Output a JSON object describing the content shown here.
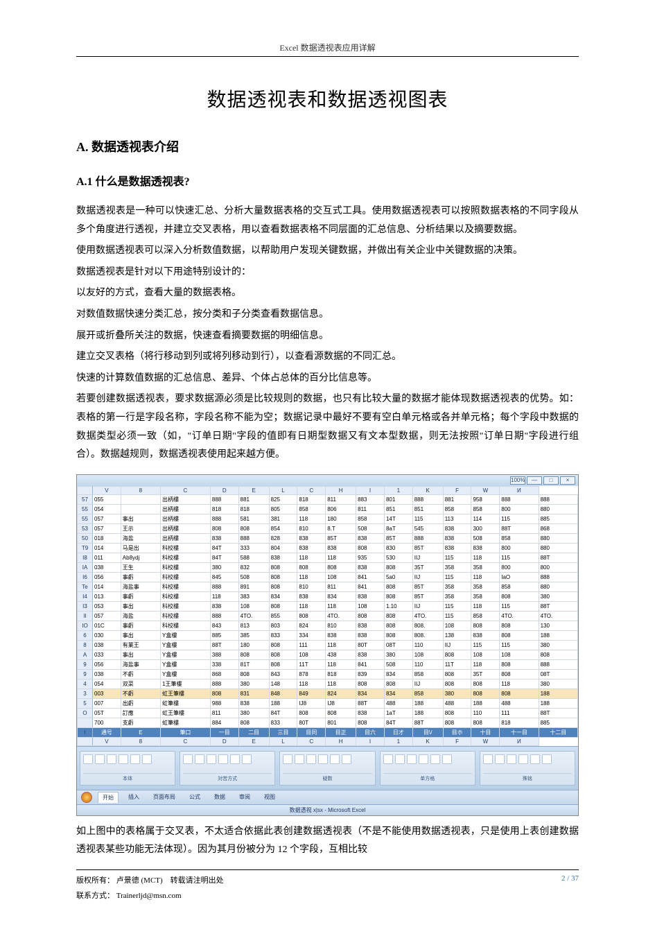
{
  "header": {
    "prefix": "Excel",
    "text": "数据透视表应用详解"
  },
  "title": "数据透视表和数据透视图表",
  "sectionA": {
    "label": "A.",
    "text": "数据透视表介绍"
  },
  "sectionA1": {
    "label": "A.1",
    "text": "什么是数据透视表",
    "qmark": "?"
  },
  "para1a": "数据透视表是一种可以快速汇总、分析大量数据表格的交互式工具。使用数据透视表可以按照数据表格的不同字段从多个角度进行透视，并建立交叉表格，用以查看数据表格不同层面的汇总信息、分析结果以及摘要数据。",
  "para1b": "使用数据透视表可以深入分析数值数据，以帮助用户发现关键数据，并做出有关企业中关键数据的决策。",
  "para2_lead": "数据透视表是针对以下用途特别设计的：",
  "para2_items": [
    "以友好的方式，查看大量的数据表格。",
    "对数值数据快速分类汇总，按分类和子分类查看数据信息。",
    "展开或折叠所关注的数据，快速查看摘要数据的明细信息。",
    "建立交叉表格（将行移动到列或将列移动到行），以查看源数据的不同汇总。",
    "快速的计算数值数据的汇总信息、差异、个体占总体的百分比信息等。"
  ],
  "para3": "若要创建数据透视表，要求数据源必须是比较规则的数据，也只有比较大量的数据才能体现数据透视表的优势。如：表格的第一行是字段名称，字段名称不能为空；数据记录中最好不要有空白单元格或各并单元格；每个字段中数据的数据类型必须一致（如，\"订单日期\"字段的值即有日期型数据又有文本型数据，则无法按照\"订单日期\"字段进行组合）。数据越规则，数据透视表使用起来越方便。",
  "excel": {
    "row_numbers": [
      "57",
      "55",
      "55",
      "53",
      "50",
      "T9",
      "I8",
      "IA",
      "I6",
      "Te",
      "I4",
      "I3",
      "II",
      "IO",
      "6",
      "8",
      "A",
      "9",
      "9",
      "4",
      "3",
      "5",
      "O"
    ],
    "col_letters": [
      "V",
      "8",
      "C",
      "D",
      "E",
      "L",
      "C",
      "H",
      "I",
      "1",
      "K",
      "F",
      "W",
      "И"
    ],
    "data_header": [
      "通号",
      "E",
      "筆口",
      "一目",
      "二目",
      "三目",
      "目同",
      "目正",
      "目六",
      "日才",
      "目\\/",
      "目ホ",
      "十目",
      "十一目",
      "十二目"
    ],
    "rows": [
      [
        "055",
        "",
        "出柄樓",
        "888",
        "881",
        "825",
        "818",
        "811",
        "883",
        "801",
        "888",
        "881",
        "958",
        "888",
        "888"
      ],
      [
        "054",
        "",
        "出柄樓",
        "818",
        "818",
        "805",
        "858",
        "806",
        "811",
        "851",
        "851",
        "858",
        "858",
        "800",
        "880"
      ],
      [
        "057",
        "事出",
        "出柄樓",
        "888",
        "581",
        "381",
        "118",
        "180",
        "858",
        "14T",
        "115",
        "113",
        "114",
        "115",
        "885"
      ],
      [
        "057",
        "王示",
        "出柄樓",
        "808",
        "808",
        "854",
        "810",
        "8.T",
        "508",
        "8aT",
        "545",
        "838",
        "300",
        "88T",
        "868"
      ],
      [
        "018",
        "海盐",
        "出柄樓",
        "838",
        "888",
        "828",
        "838",
        "85T",
        "838",
        "85T",
        "888",
        "838",
        "508",
        "858",
        "880"
      ],
      [
        "014",
        "马是出",
        "科校樓",
        "84T",
        "333",
        "804",
        "838",
        "838",
        "808",
        "830",
        "85T",
        "838",
        "838",
        "800",
        "880"
      ],
      [
        "011",
        "Ab8ydj",
        "科校樓",
        "84T",
        "588",
        "838",
        "118",
        "118",
        "935",
        "530",
        "IIJ",
        "115",
        "118",
        "115",
        "88T"
      ],
      [
        "038",
        "王生",
        "科校樓",
        "380",
        "832",
        "808",
        "808",
        "808",
        "838",
        "808",
        "35T",
        "358",
        "358",
        "800",
        "800"
      ],
      [
        "056",
        "事虧",
        "科校樓",
        "845",
        "508",
        "808",
        "118",
        "108",
        "841",
        "5a0",
        "IIJ",
        "115",
        "118",
        "IaO",
        "888"
      ],
      [
        "014",
        "海盐事",
        "科校樓",
        "888",
        "891",
        "808",
        "810",
        "811",
        "841",
        "808",
        "85T",
        "358",
        "358",
        "858",
        "880"
      ],
      [
        "013",
        "事虧",
        "科校樓",
        "118",
        "383",
        "834",
        "838",
        "834",
        "838",
        "808",
        "85T",
        "358",
        "358",
        "808",
        "380"
      ],
      [
        "053",
        "事出",
        "科校樓",
        "838",
        "108",
        "808",
        "118",
        "118",
        "108",
        "1.10",
        "IIJ",
        "115",
        "118",
        "115",
        "88T"
      ],
      [
        "057",
        "海盐",
        "科校樓",
        "888",
        "4TO.",
        "855",
        "808",
        "4TO.",
        "808",
        "808",
        "4TO.",
        "115",
        "858",
        "4TO.",
        "4TO."
      ],
      [
        "01C",
        "事虧",
        "科校樓",
        "843",
        "813",
        "803",
        "824",
        "810",
        "838",
        "808",
        "808.",
        "108",
        "808",
        "808",
        "130"
      ],
      [
        "030",
        "事出",
        "Y盒樓",
        "885",
        "385",
        "833",
        "334",
        "838",
        "838",
        "808",
        "808.",
        "138",
        "838",
        "808",
        "188"
      ],
      [
        "038",
        "有業王",
        "Y盒樓",
        "88T",
        "180",
        "808",
        "111",
        "118",
        "80T",
        "08T",
        "110",
        "IIJ",
        "115",
        "115",
        "380"
      ],
      [
        "033",
        "事出",
        "Y盒樓",
        "388",
        "808",
        "808",
        "108",
        "438",
        "838",
        "380",
        "108",
        "808",
        "108",
        "108",
        "808"
      ],
      [
        "056",
        "海盐事",
        "Y盒樓",
        "338",
        "81T",
        "808",
        "11T",
        "118",
        "841",
        "508",
        "110",
        "11T",
        "118",
        "808",
        "888"
      ],
      [
        "038",
        "不虧",
        "Y盒樓",
        "868",
        "808",
        "843",
        "878",
        "818",
        "839",
        "834",
        "858",
        "808",
        "35T",
        "808",
        "08T"
      ],
      [
        "054",
        "双菜",
        "1王筆樓",
        "888",
        "380",
        "148",
        "118",
        "118",
        "808",
        "808",
        "IIJ",
        "808",
        "808",
        "118",
        "380"
      ],
      [
        "003",
        "不虧",
        "虹王筆樓",
        "808",
        "831",
        "848",
        "849",
        "824",
        "834",
        "834",
        "858",
        "380",
        "808",
        "808",
        "188"
      ],
      [
        "007",
        "出虧",
        "虹筆樓",
        "988",
        "838",
        "188",
        "IJ8",
        "IJ8",
        "88T",
        "488",
        "188",
        "488",
        "188",
        "488",
        "188"
      ],
      [
        "05T",
        "訂應",
        "虹王筆樓",
        "811",
        "380",
        "84T",
        "808",
        "808",
        "838",
        "1aT",
        "188",
        "808",
        "110",
        "111",
        "88T"
      ],
      [
        "700",
        "支虧",
        "虹筆樓",
        "884",
        "808",
        "833",
        "80T",
        "801",
        "808",
        "84T",
        "88T",
        "808",
        "808",
        "818",
        "885"
      ]
    ],
    "ribbon_groups": [
      "本体",
      "対苦方式",
      "疑数",
      "单方格",
      "殊铭"
    ],
    "tabs": [
      "开始",
      "插入",
      "页面布局",
      "公式",
      "数据",
      "审阅",
      "视图"
    ],
    "title_text": "数据透视 x|sx - Microsoft Excel",
    "winbtn_left": "100%"
  },
  "para4": "如上图中的表格属于交叉表，不太适合依据此表创建数据透视表（不是不能使用数据透视表，只是使用上表创建数据透视表某些功能无法体现）。因为其月份被分为 12 个字段，互相比较",
  "footer": {
    "copyright_label": "版权所有：",
    "author": "卢景德",
    "author_en": "(MCT)",
    "repost": "转载请注明出处",
    "page_cur": "2",
    "page_sep": " / ",
    "page_total": "37",
    "contact_label": "联系方式：",
    "contact_value": "Trainerljd@msn.com"
  }
}
